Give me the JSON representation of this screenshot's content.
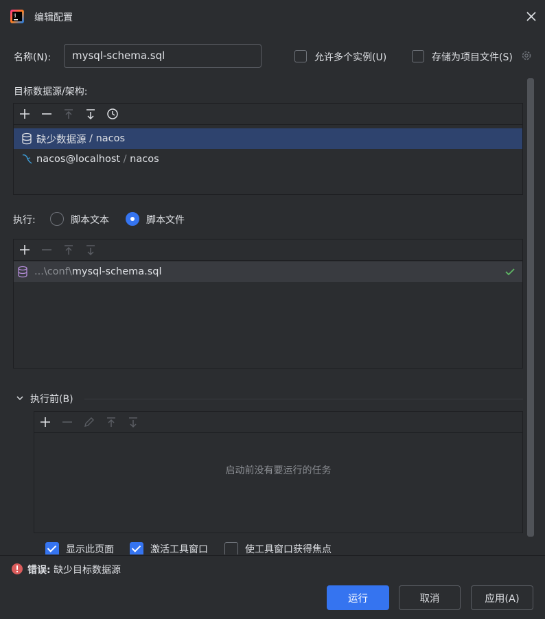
{
  "window": {
    "title": "编辑配置"
  },
  "name_field": {
    "label": "名称(N):",
    "value": "mysql-schema.sql"
  },
  "options": {
    "allow_multiple": {
      "label": "允许多个实例(U)",
      "checked": false
    },
    "store_as_project": {
      "label": "存储为项目文件(S)",
      "checked": false
    }
  },
  "targets": {
    "label": "目标数据源/架构:",
    "items": [
      {
        "icon": "database-icon",
        "name": "缺少数据源",
        "sep": " / ",
        "schema": "nacos",
        "selected": true
      },
      {
        "icon": "mysql-dolphin-icon",
        "name": "nacos@localhost",
        "sep": " / ",
        "schema": "nacos",
        "selected": false
      }
    ]
  },
  "execute": {
    "label": "执行:",
    "option_text": "脚本文本",
    "option_file": "脚本文件",
    "selected": "脚本文件",
    "files": [
      {
        "prefix": "...\\conf\\",
        "name": "mysql-schema.sql",
        "status": "check-icon"
      }
    ]
  },
  "before_launch": {
    "label": "执行前(B)",
    "empty_text": "启动前没有要运行的任务",
    "opt_show_page": "显示此页面",
    "opt_activate_window": "激活工具窗口",
    "opt_focus_window": "使工具窗口获得焦点"
  },
  "error": {
    "prefix": "错误:",
    "message": "缺少目标数据源"
  },
  "buttons": {
    "run": "运行",
    "cancel": "取消",
    "apply": "应用(A)"
  },
  "colors": {
    "accent": "#3574f0",
    "background": "#2b2d30",
    "selection": "#2e436e",
    "error": "#db5c5c",
    "success": "#5fb865"
  }
}
